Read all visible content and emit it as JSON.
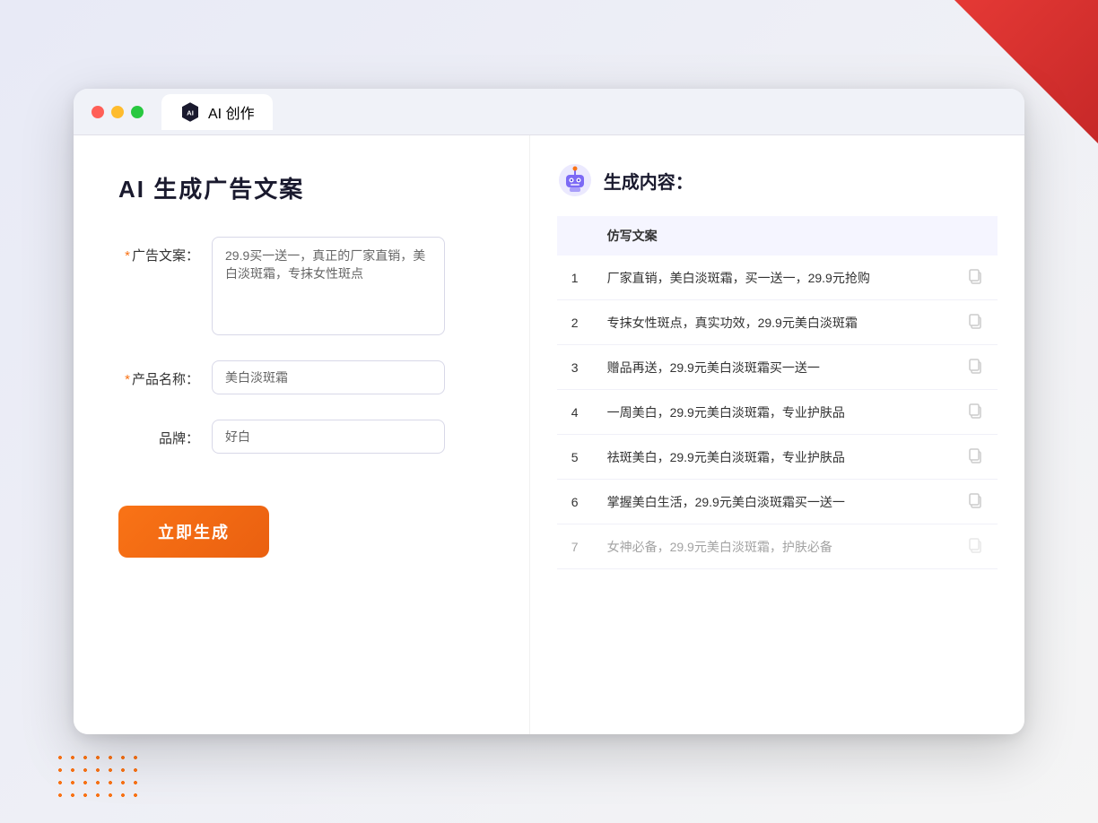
{
  "window": {
    "tab_label": "AI 创作"
  },
  "left_panel": {
    "title": "AI 生成广告文案",
    "form": {
      "ad_copy_label": "广告文案：",
      "ad_copy_required": "*",
      "ad_copy_value": "29.9买一送一，真正的厂家直销，美白淡斑霜，专抹女性斑点",
      "product_name_label": "产品名称：",
      "product_name_required": "*",
      "product_name_value": "美白淡斑霜",
      "brand_label": "品牌：",
      "brand_value": "好白"
    },
    "generate_button": "立即生成"
  },
  "right_panel": {
    "title": "生成内容：",
    "table": {
      "header": "仿写文案",
      "rows": [
        {
          "num": "1",
          "text": "厂家直销，美白淡斑霜，买一送一，29.9元抢购"
        },
        {
          "num": "2",
          "text": "专抹女性斑点，真实功效，29.9元美白淡斑霜"
        },
        {
          "num": "3",
          "text": "赠品再送，29.9元美白淡斑霜买一送一"
        },
        {
          "num": "4",
          "text": "一周美白，29.9元美白淡斑霜，专业护肤品"
        },
        {
          "num": "5",
          "text": "祛斑美白，29.9元美白淡斑霜，专业护肤品"
        },
        {
          "num": "6",
          "text": "掌握美白生活，29.9元美白淡斑霜买一送一"
        },
        {
          "num": "7",
          "text": "女神必备，29.9元美白淡斑霜，护肤必备"
        }
      ]
    }
  },
  "colors": {
    "orange": "#f97316",
    "purple": "#6366f1",
    "required": "#f97316"
  }
}
